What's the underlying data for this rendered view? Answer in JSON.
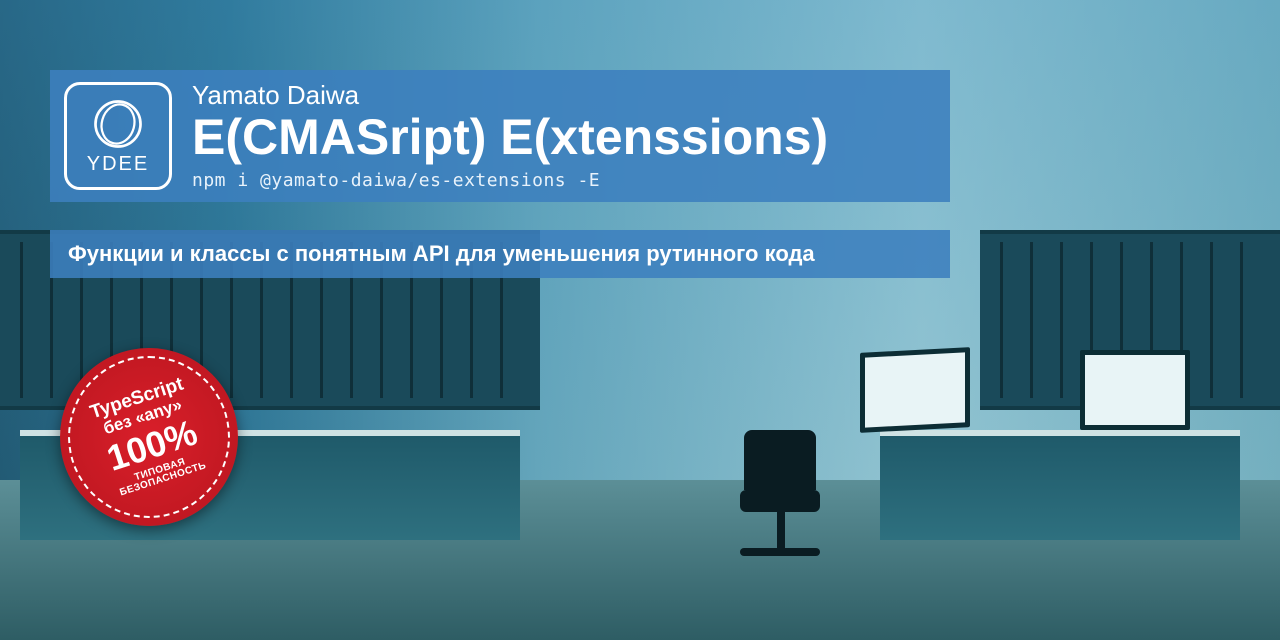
{
  "logo": {
    "label": "YDEE"
  },
  "header": {
    "brand": "Yamato Daiwa",
    "title": "E(CMASript) E(xtenssions)",
    "install_command": "npm i @yamato-daiwa/es-extensions -E"
  },
  "tagline": "Функции и классы с понятным API для уменьшения рутинного кода",
  "badge": {
    "line1": "TypeScript",
    "line2": "без «any»",
    "percent": "100%",
    "line4": "ТИПОВАЯ",
    "line5": "БЕЗОПАСНОСТЬ"
  },
  "colors": {
    "panel": "#3c80be",
    "badge": "#c0181f"
  }
}
